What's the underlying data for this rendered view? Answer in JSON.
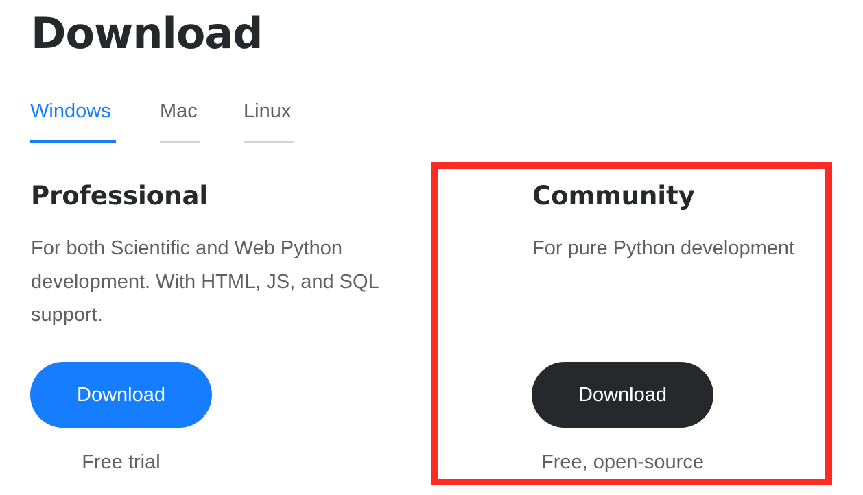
{
  "page": {
    "title": "Download"
  },
  "tabs": [
    {
      "label": "Windows",
      "active": true
    },
    {
      "label": "Mac",
      "active": false
    },
    {
      "label": "Linux",
      "active": false
    }
  ],
  "editions": {
    "professional": {
      "title": "Professional",
      "description": "For both Scientific and Web Python development. With HTML, JS, and SQL support.",
      "button_label": "Download",
      "note": "Free trial"
    },
    "community": {
      "title": "Community",
      "description": "For pure Python development",
      "button_label": "Download",
      "note": "Free, open-source"
    }
  },
  "colors": {
    "accent": "#167dff",
    "dark_button": "#27282c",
    "text": "#27282c",
    "muted_text": "#5f6063",
    "highlight": "#ff2a22"
  }
}
